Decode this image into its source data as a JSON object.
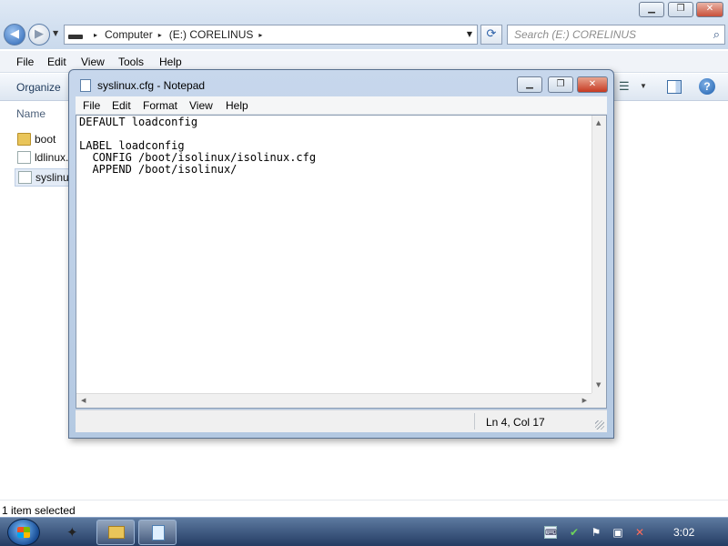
{
  "explorer": {
    "address": {
      "segments": [
        "Computer",
        "(E:) CORELINUS"
      ],
      "separator": "▸"
    },
    "search_placeholder": "Search (E:) CORELINUS",
    "menu": [
      "File",
      "Edit",
      "View",
      "Tools",
      "Help"
    ],
    "toolbar": {
      "organize_label": "Organize"
    },
    "column_header": "Name",
    "files": [
      {
        "name": "boot",
        "icon": "folder-icon"
      },
      {
        "name": "ldlinux.",
        "icon": "file-icon"
      },
      {
        "name": "syslinux",
        "icon": "file-icon",
        "selected": true
      }
    ],
    "status": "1 item selected"
  },
  "notepad": {
    "title": "syslinux.cfg - Notepad",
    "menu": [
      "File",
      "Edit",
      "Format",
      "View",
      "Help"
    ],
    "content": "DEFAULT loadconfig\n\nLABEL loadconfig\n  CONFIG /boot/isolinux/isolinux.cfg\n  APPEND /boot/isolinux/",
    "cursor_position": "Ln 4, Col 17"
  },
  "taskbar": {
    "clock": "3:02"
  },
  "colors": {
    "titlebar": "#dfe9f5",
    "taskbar": "#243c63",
    "selection": "#e3ebf6"
  }
}
